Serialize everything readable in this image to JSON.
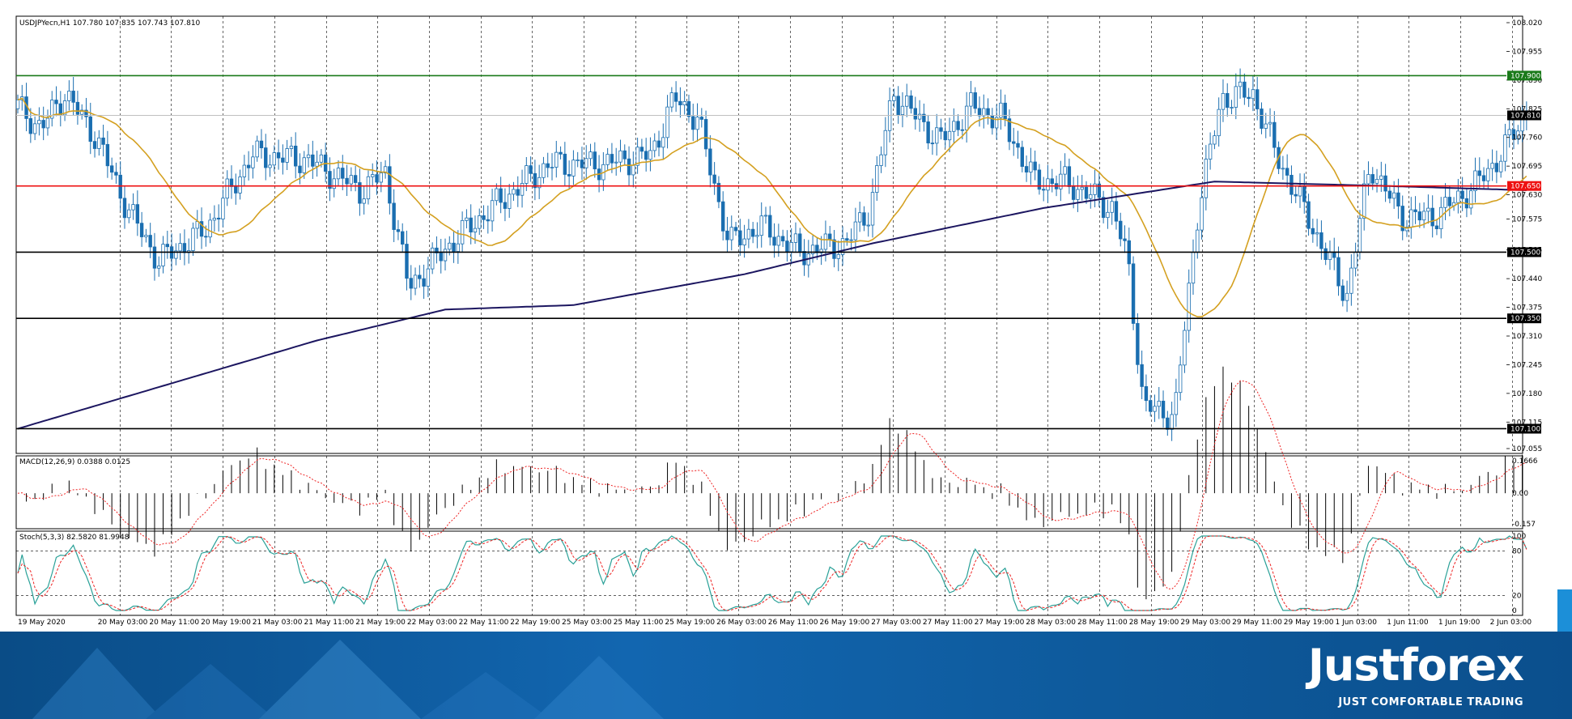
{
  "main_header": "USDJPYecn,H1  107.780 107.835 107.743 107.810",
  "macd_header": "MACD(12,26,9) 0.0388 0.0125",
  "stoch_header": "Stoch(5,3,3) 82.5820 81.9948",
  "price_ticks": [
    "108.020",
    "107.955",
    "107.890",
    "107.825",
    "107.760",
    "107.695",
    "107.630",
    "107.575",
    "107.505",
    "107.440",
    "107.375",
    "107.310",
    "107.245",
    "107.180",
    "107.115",
    "107.055"
  ],
  "level_tags": [
    {
      "label": "107.900",
      "value": 107.9,
      "bg": "#1a7a1a",
      "fg": "#ffffff"
    },
    {
      "label": "107.810",
      "value": 107.81,
      "bg": "#000000",
      "fg": "#ffffff"
    },
    {
      "label": "107.650",
      "value": 107.65,
      "bg": "#ee1111",
      "fg": "#ffffff"
    },
    {
      "label": "107.500",
      "value": 107.5,
      "bg": "#000000",
      "fg": "#ffffff"
    },
    {
      "label": "107.350",
      "value": 107.35,
      "bg": "#000000",
      "fg": "#ffffff"
    },
    {
      "label": "107.100",
      "value": 107.1,
      "bg": "#000000",
      "fg": "#ffffff"
    }
  ],
  "macd_ticks": [
    "0.1666",
    "0.00",
    "-0.157"
  ],
  "stoch_ticks": [
    "100",
    "80",
    "20",
    "0"
  ],
  "time_ticks": [
    "19 May 2020",
    "20 May 03:00",
    "20 May 11:00",
    "20 May 19:00",
    "21 May 03:00",
    "21 May 11:00",
    "21 May 19:00",
    "22 May 03:00",
    "22 May 11:00",
    "22 May 19:00",
    "25 May 03:00",
    "25 May 11:00",
    "25 May 19:00",
    "26 May 03:00",
    "26 May 11:00",
    "26 May 19:00",
    "27 May 03:00",
    "27 May 11:00",
    "27 May 19:00",
    "28 May 03:00",
    "28 May 11:00",
    "28 May 19:00",
    "29 May 03:00",
    "29 May 11:00",
    "29 May 19:00",
    "1 Jun 03:00",
    "1 Jun 11:00",
    "1 Jun 19:00",
    "2 Jun 03:00"
  ],
  "brand": {
    "name": "Justforex",
    "tagline": "JUST COMFORTABLE TRADING"
  },
  "colors": {
    "bull": "#ffffff",
    "bear": "#1a6eb0",
    "candle_edge": "#1a6eb0",
    "ma_fast": "#d4a020",
    "ma_slow": "#1c1660",
    "resistance": "#1a7a1a",
    "pivot": "#ee1111",
    "support": "#000000",
    "last_price": "#c0c0c0",
    "macd_signal": "#ee2222",
    "stoch_main": "#2aa198",
    "stoch_signal": "#ee2222"
  },
  "chart_data": {
    "type": "candlestick",
    "symbol": "USDJPYecn",
    "timeframe": "H1",
    "ohlc_last": {
      "open": 107.78,
      "high": 107.835,
      "low": 107.743,
      "close": 107.81
    },
    "ylim": [
      107.055,
      108.02
    ],
    "horizontal_levels": [
      107.9,
      107.81,
      107.65,
      107.5,
      107.35,
      107.1
    ],
    "approx_close_path": [
      {
        "label": "19 May 2020",
        "close": 107.83
      },
      {
        "label": "20 May 03:00",
        "close": 107.86
      },
      {
        "label": "20 May 11:00",
        "close": 107.48
      },
      {
        "label": "20 May 19:00",
        "close": 107.55
      },
      {
        "label": "21 May 03:00",
        "close": 107.72
      },
      {
        "label": "21 May 11:00",
        "close": 107.71
      },
      {
        "label": "21 May 19:00",
        "close": 107.64
      },
      {
        "label": "22 May 03:00",
        "close": 107.42
      },
      {
        "label": "22 May 11:00",
        "close": 107.53
      },
      {
        "label": "22 May 19:00",
        "close": 107.62
      },
      {
        "label": "25 May 03:00",
        "close": 107.7
      },
      {
        "label": "25 May 11:00",
        "close": 107.7
      },
      {
        "label": "25 May 19:00",
        "close": 107.72
      },
      {
        "label": "26 May 03:00",
        "close": 107.85
      },
      {
        "label": "26 May 11:00",
        "close": 107.52
      },
      {
        "label": "26 May 19:00",
        "close": 107.5
      },
      {
        "label": "27 May 03:00",
        "close": 107.52
      },
      {
        "label": "27 May 11:00",
        "close": 107.86
      },
      {
        "label": "27 May 19:00",
        "close": 107.75
      },
      {
        "label": "28 May 03:00",
        "close": 107.83
      },
      {
        "label": "28 May 11:00",
        "close": 107.66
      },
      {
        "label": "28 May 19:00",
        "close": 107.6
      },
      {
        "label": "29 May 03:00",
        "close": 107.13
      },
      {
        "label": "29 May 11:00",
        "close": 107.66
      },
      {
        "label": "29 May 19:00",
        "close": 107.72
      },
      {
        "label": "1 Jun 03:00",
        "close": 107.58
      },
      {
        "label": "1 Jun 11:00",
        "close": 107.58
      },
      {
        "label": "1 Jun 19:00",
        "close": 107.63
      },
      {
        "label": "2 Jun 03:00",
        "close": 107.81
      }
    ],
    "macd": {
      "ylim": [
        -0.157,
        0.1666
      ],
      "main": 0.0388,
      "signal": 0.0125
    },
    "stochastic": {
      "ylim": [
        0,
        100
      ],
      "k": 82.582,
      "d": 81.9948,
      "levels": [
        80,
        20
      ]
    }
  }
}
